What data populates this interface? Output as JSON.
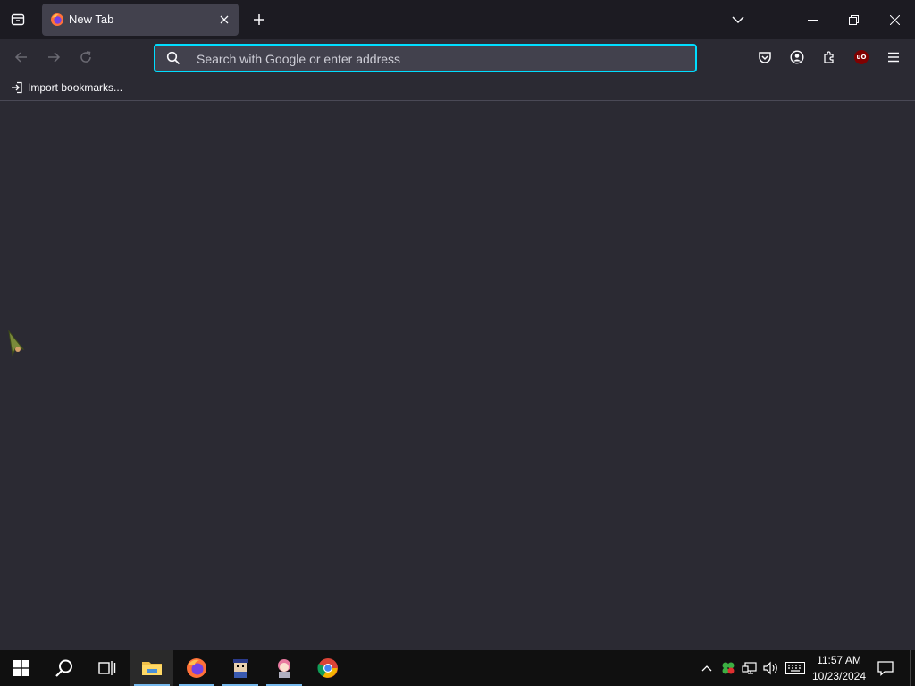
{
  "browser": {
    "tab": {
      "title": "New Tab"
    },
    "urlbar": {
      "placeholder": "Search with Google or enter address",
      "value": ""
    },
    "bookmarks": {
      "import_label": "Import bookmarks..."
    }
  },
  "taskbar": {
    "clock": {
      "time": "11:57 AM",
      "date": "10/23/2024"
    }
  },
  "colors": {
    "accent": "#00ddff",
    "background": "#2b2a33",
    "tabstrip": "#1c1b22"
  }
}
